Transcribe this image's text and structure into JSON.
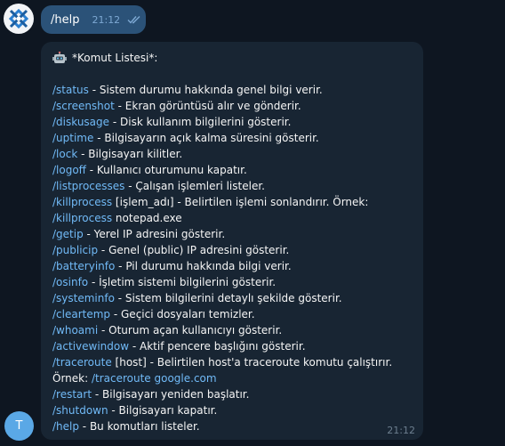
{
  "outgoing": {
    "text": "/help",
    "time": "21:12",
    "status_icon": "double-check-icon"
  },
  "incoming": {
    "header_icon": "robot-icon",
    "header": "*Komut Listesi*:",
    "time": "21:12",
    "lines": [
      {
        "cmd": "/status",
        "rest": " - Sistem durumu hakkında genel bilgi verir."
      },
      {
        "cmd": "/screenshot",
        "rest": " - Ekran görüntüsü alır ve gönderir."
      },
      {
        "cmd": "/diskusage",
        "rest": " - Disk kullanım bilgilerini gösterir."
      },
      {
        "cmd": "/uptime",
        "rest": " - Bilgisayarın açık kalma süresini gösterir."
      },
      {
        "cmd": "/lock",
        "rest": " - Bilgisayarı kilitler."
      },
      {
        "cmd": "/logoff",
        "rest": " - Kullanıcı oturumunu kapatır."
      },
      {
        "cmd": "/listprocesses",
        "rest": " - Çalışan işlemleri listeler."
      },
      {
        "cmd": "/killprocess",
        "rest": " [işlem_adı] - Belirtilen işlemi sonlandırır. Örnek:"
      },
      {
        "cmd": "/killprocess",
        "rest": " notepad.exe"
      },
      {
        "cmd": "/getip",
        "rest": " - Yerel IP adresini gösterir."
      },
      {
        "cmd": "/publicip",
        "rest": " - Genel (public) IP adresini gösterir."
      },
      {
        "cmd": "/batteryinfo",
        "rest": " - Pil durumu hakkında bilgi verir."
      },
      {
        "cmd": "/osinfo",
        "rest": " - İşletim sistemi bilgilerini gösterir."
      },
      {
        "cmd": "/systeminfo",
        "rest": " - Sistem bilgilerini detaylı şekilde gösterir."
      },
      {
        "cmd": "/cleartemp",
        "rest": " - Geçici dosyaları temizler."
      },
      {
        "cmd": "/whoami",
        "rest": " - Oturum açan kullanıcıyı gösterir."
      },
      {
        "cmd": "/activewindow",
        "rest": " - Aktif pencere başlığını gösterir."
      },
      {
        "cmd": "/traceroute",
        "rest": " [host] - Belirtilen host'a traceroute komutu çalıştırır."
      },
      {
        "pre": "Örnek: ",
        "cmd": "/traceroute google.com",
        "rest": ""
      },
      {
        "cmd": "/restart",
        "rest": " - Bilgisayarı yeniden başlatır."
      },
      {
        "cmd": "/shutdown",
        "rest": " - Bilgisayarı kapatır."
      },
      {
        "cmd": "/help",
        "rest": " - Bu komutları listeler."
      }
    ]
  },
  "user_avatar": {
    "letter": "T",
    "color": "#5aa8e6"
  },
  "bot_avatar": {
    "icon": "bot-logo-icon"
  },
  "colors": {
    "background": "#0e1621",
    "outgoing_bubble": "#2b5278",
    "incoming_bubble": "#182533",
    "link": "#71baf7"
  }
}
